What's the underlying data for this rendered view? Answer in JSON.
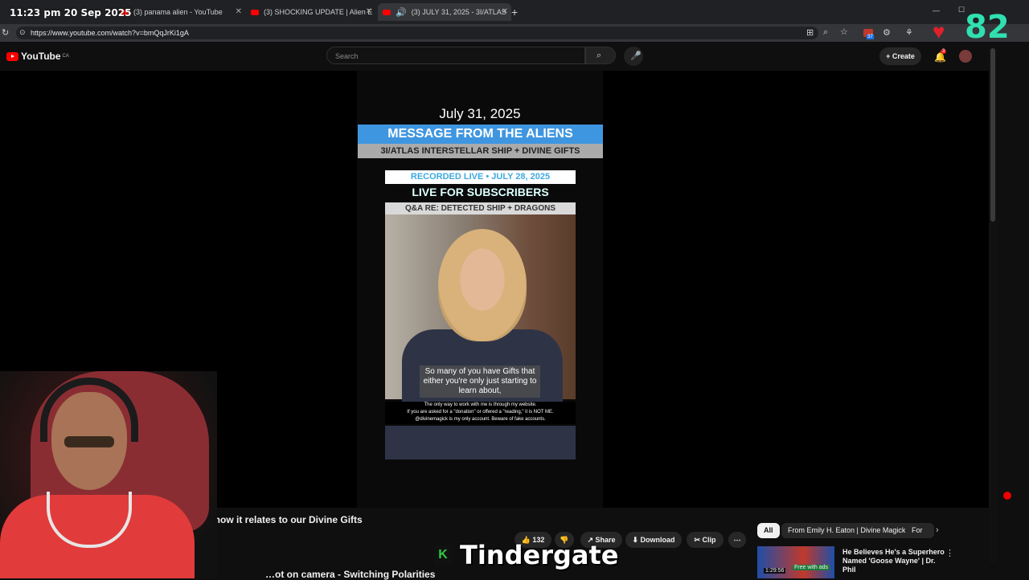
{
  "overlay": {
    "clock": "11:23 pm  20 Sep 2025",
    "counter": "82",
    "brand_text": "Tindergate"
  },
  "browser": {
    "tabs": [
      {
        "title": "(3) panama alien - YouTube"
      },
      {
        "title": "(3) SHOCKING UPDATE | Alien E"
      },
      {
        "title": "(3) JULY 31, 2025 - 3I/ATLAS"
      }
    ],
    "url": "https://www.youtube.com/watch?v=bmQqJrKi1gA",
    "extension_badge": "37"
  },
  "youtube": {
    "logo_text": "YouTube",
    "region": "CA",
    "search_placeholder": "Search",
    "create_label": "Create",
    "notification_count": "3"
  },
  "video": {
    "date": "July 31, 2025",
    "banner_title": "MESSAGE FROM THE ALIENS",
    "banner_subtitle": "3I/ATLAS INTERSTELLAR SHIP + DIVINE GIFTS",
    "recorded": "RECORDED LIVE • JULY 28, 2025",
    "live_for": "LIVE FOR SUBSCRIBERS",
    "qa": "Q&A RE: DETECTED SHIP + DRAGONS",
    "subtitle": "So many of you have Gifts that either you're only just starting to learn about,",
    "note_lines": [
      "The only way to work with me is through my website.",
      "If you are asked for a \"donation\" or offered a \"reading,\" it is NOT ME.",
      "@divinemagick is my only account. Beware of fake accounts."
    ]
  },
  "below": {
    "title_fragment": "and how it relates to our Divine Gifts",
    "likes": "132",
    "share": "Share",
    "download": "Download",
    "clip": "Clip",
    "chips": [
      "All",
      "From Emily H. Eaton | Divine Magick",
      "For y"
    ],
    "suggestion_title": "He Believes He's a Superhero Named 'Goose Wayne' | Dr. Phil",
    "suggestion_duration": "1:29:56",
    "suggestion_badge": "Free with ads",
    "bottom_title": "…ot on camera - Switching Polarities"
  }
}
